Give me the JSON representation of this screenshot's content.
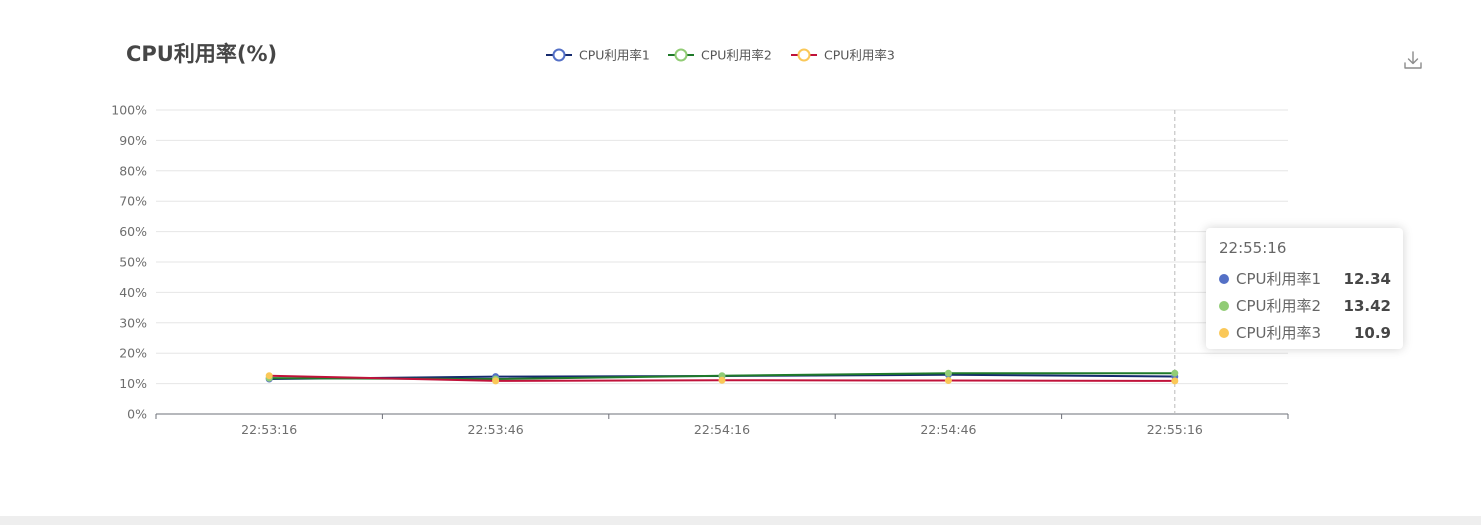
{
  "chart_data": {
    "type": "line",
    "title": "CPU利用率(%)",
    "categories": [
      "22:53:16",
      "22:53:46",
      "22:54:16",
      "22:54:46",
      "22:55:16"
    ],
    "y_tick_labels": [
      "0%",
      "10%",
      "20%",
      "30%",
      "40%",
      "50%",
      "60%",
      "70%",
      "80%",
      "90%",
      "100%"
    ],
    "ylim": [
      0,
      100
    ],
    "grid": true,
    "legend_position": "top-center",
    "series": [
      {
        "name": "CPU利用率1",
        "values": [
          11.5,
          12.3,
          12.5,
          12.9,
          12.34
        ],
        "line_color": "#152a6e",
        "marker_color": "#5470c6"
      },
      {
        "name": "CPU利用率2",
        "values": [
          11.8,
          11.5,
          12.6,
          13.4,
          13.42
        ],
        "line_color": "#1f7a2a",
        "marker_color": "#91cc75"
      },
      {
        "name": "CPU利用率3",
        "values": [
          12.6,
          10.9,
          11.1,
          11.0,
          10.9
        ],
        "line_color": "#c0123a",
        "marker_color": "#fac858"
      }
    ]
  },
  "tooltip": {
    "time": "22:55:16",
    "rows": [
      {
        "name": "CPU利用率1",
        "value": "12.34",
        "color": "#5470c6"
      },
      {
        "name": "CPU利用率2",
        "value": "13.42",
        "color": "#91cc75"
      },
      {
        "name": "CPU利用率3",
        "value": "10.9",
        "color": "#fac858"
      }
    ]
  },
  "download_icon": "download-icon"
}
